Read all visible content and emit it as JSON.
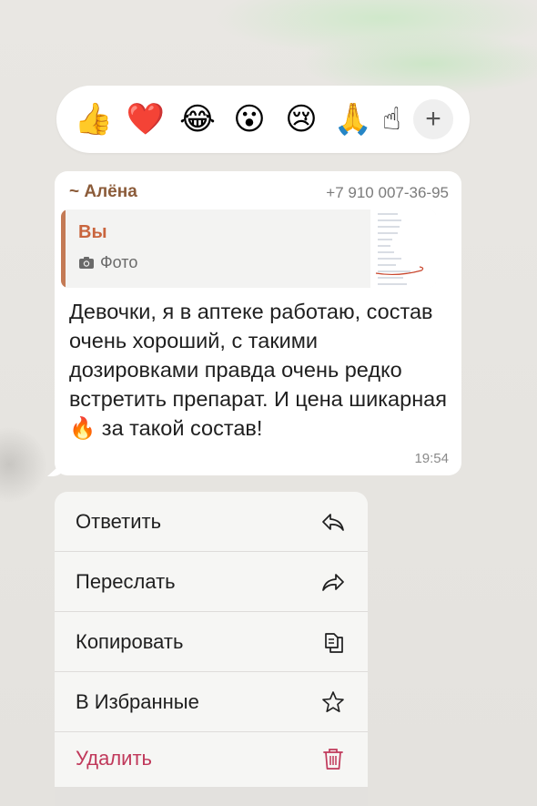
{
  "reactions": {
    "items": [
      {
        "name": "thumbs-up",
        "glyph": "👍"
      },
      {
        "name": "red-heart",
        "glyph": "❤️"
      },
      {
        "name": "tears-of-joy",
        "glyph": "😂"
      },
      {
        "name": "open-mouth",
        "glyph": "😮"
      },
      {
        "name": "crying",
        "glyph": "😢"
      },
      {
        "name": "folded-hands",
        "glyph": "🙏"
      },
      {
        "name": "partial-emoji",
        "glyph": "☝"
      }
    ],
    "more_label": "+"
  },
  "message": {
    "sender_name": "~ Алёна",
    "sender_phone": "+7 910 007-36-95",
    "quote": {
      "author": "Вы",
      "type_label": "Фото"
    },
    "text": "Девочки, я в аптеке работаю, состав очень хороший, с такими дозировками правда очень редко встретить препарат. И цена шикарная 🔥 за такой состав!",
    "time": "19:54"
  },
  "menu": {
    "items": [
      {
        "label": "Ответить",
        "icon": "reply-icon"
      },
      {
        "label": "Переслать",
        "icon": "forward-icon"
      },
      {
        "label": "Копировать",
        "icon": "copy-icon"
      },
      {
        "label": "В Избранные",
        "icon": "star-icon"
      },
      {
        "label": "Удалить",
        "icon": "trash-icon"
      }
    ]
  },
  "colors": {
    "sender": "#8b5b39",
    "quote_author": "#c9653e",
    "quote_bar": "#c47a55",
    "danger": "#c0385a"
  }
}
